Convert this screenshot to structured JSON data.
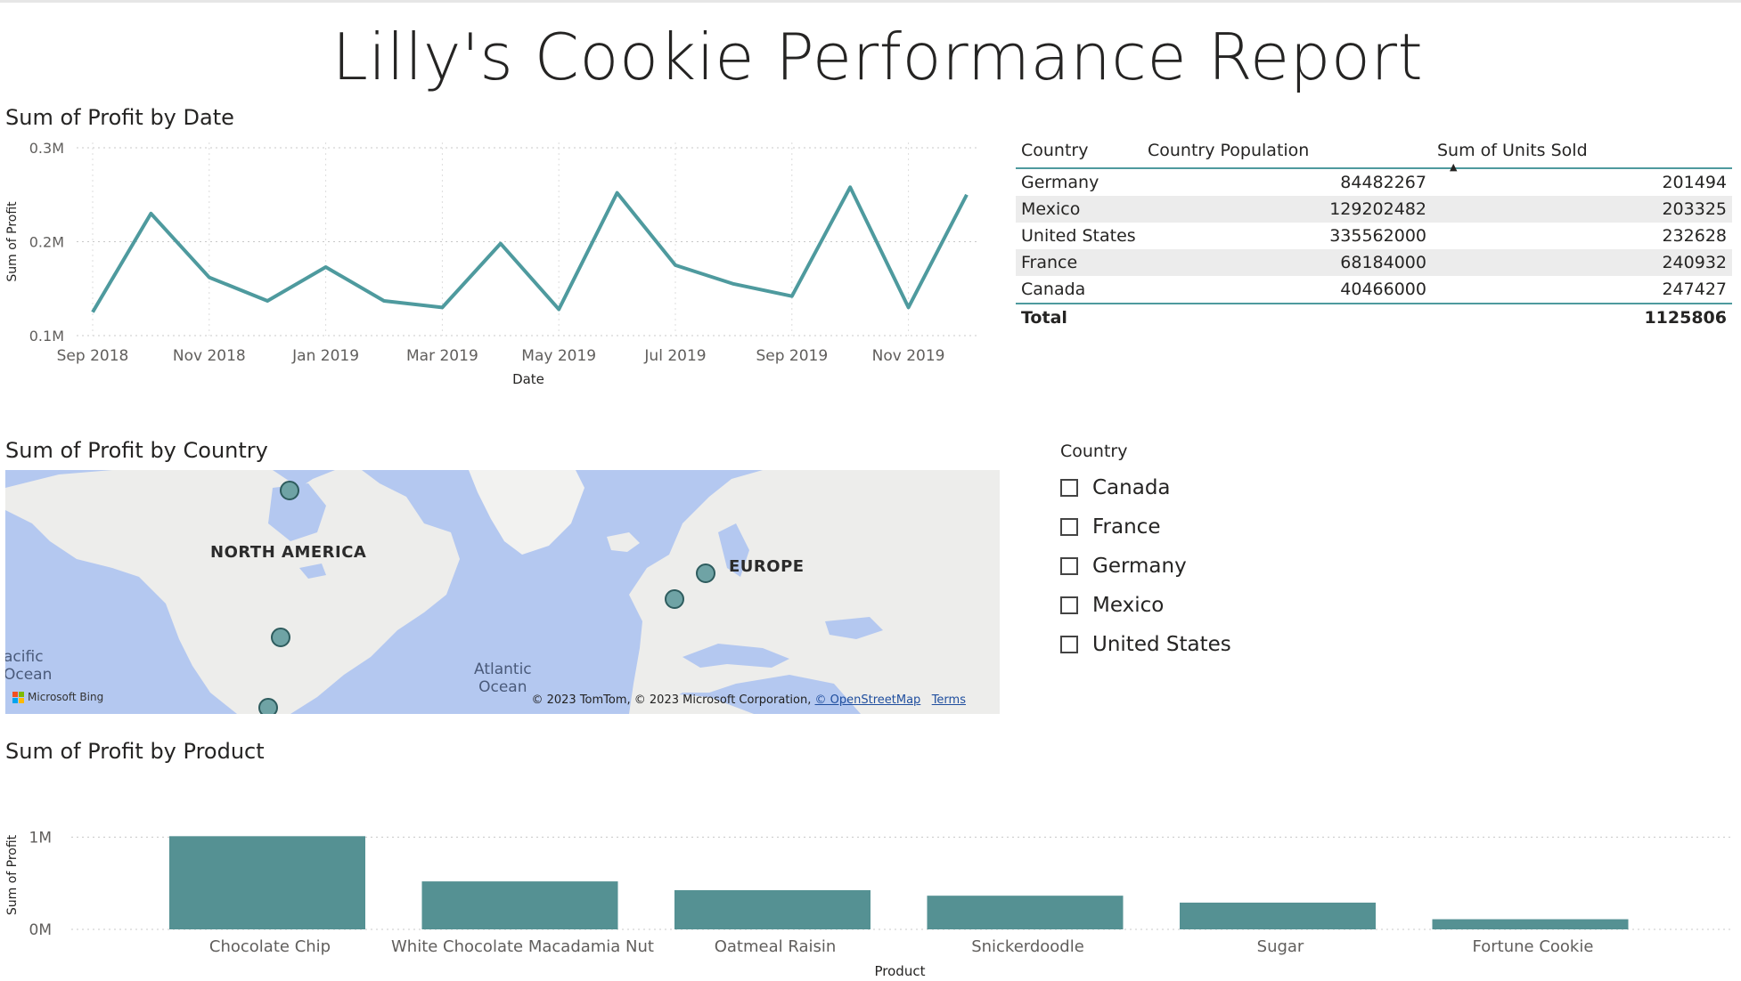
{
  "report": {
    "title": "Lilly's Cookie Performance Report"
  },
  "line_chart": {
    "title": "Sum of Profit by Date",
    "xlabel": "Date",
    "ylabel": "Sum of Profit",
    "ytick_labels": [
      "0.3M",
      "0.2M",
      "0.1M"
    ],
    "xtick_labels": [
      "Sep 2018",
      "Nov 2018",
      "Jan 2019",
      "Mar 2019",
      "May 2019",
      "Jul 2019",
      "Sep 2019",
      "Nov 2019"
    ]
  },
  "bar_chart": {
    "title": "Sum of Profit by Product",
    "xlabel": "Product",
    "ylabel": "Sum of Profit",
    "ytick_labels": [
      "1M",
      "0M"
    ]
  },
  "chart_data": [
    {
      "type": "line",
      "title": "Sum of Profit by Date",
      "xlabel": "Date",
      "ylabel": "Sum of Profit",
      "x": [
        "2018-09",
        "2018-10",
        "2018-11",
        "2018-12",
        "2019-01",
        "2019-02",
        "2019-03",
        "2019-04",
        "2019-05",
        "2019-06",
        "2019-07",
        "2019-08",
        "2019-09",
        "2019-10",
        "2019-11",
        "2019-12"
      ],
      "values": [
        125000,
        230000,
        162000,
        137000,
        173000,
        137000,
        130000,
        198000,
        128000,
        252000,
        175000,
        155000,
        142000,
        258000,
        130000,
        250000
      ],
      "ylim": [
        100000,
        300000
      ],
      "grid": true,
      "color": "#4e9a9e"
    },
    {
      "type": "bar",
      "title": "Sum of Profit by Product",
      "xlabel": "Product",
      "ylabel": "Sum of Profit",
      "categories": [
        "Chocolate Chip",
        "White Chocolate Macadamia Nut",
        "Oatmeal Raisin",
        "Snickerdoodle",
        "Sugar",
        "Fortune Cookie"
      ],
      "values": [
        1010000,
        520000,
        425000,
        365000,
        290000,
        110000
      ],
      "ylim": [
        0,
        1100000
      ],
      "grid": true,
      "color": "#559193"
    }
  ],
  "table": {
    "headers": [
      "Country",
      "Country Population",
      "Sum of Units Sold"
    ],
    "rows": [
      [
        "Germany",
        "84482267",
        "201494"
      ],
      [
        "Mexico",
        "129202482",
        "203325"
      ],
      [
        "United States",
        "335562000",
        "232628"
      ],
      [
        "France",
        "68184000",
        "240932"
      ],
      [
        "Canada",
        "40466000",
        "247427"
      ]
    ],
    "total_label": "Total",
    "total_value": "1125806",
    "sort_indicator": "▲"
  },
  "map": {
    "title": "Sum of Profit by Country",
    "labels": [
      "NORTH AMERICA",
      "EUROPE"
    ],
    "ocean_atlantic": "Atlantic\nOcean",
    "ocean_pacific": "acific\nOcean",
    "brand": "Microsoft Bing",
    "attribution": "© 2023 TomTom, © 2023 Microsoft Corporation,",
    "attribution_link": "© OpenStreetMap",
    "terms": "Terms",
    "colors": {
      "water": "#b4c8f0",
      "land": "#ededeb",
      "bubble": "#6fa3a5"
    }
  },
  "slicer": {
    "title": "Country",
    "items": [
      "Canada",
      "France",
      "Germany",
      "Mexico",
      "United States"
    ]
  }
}
